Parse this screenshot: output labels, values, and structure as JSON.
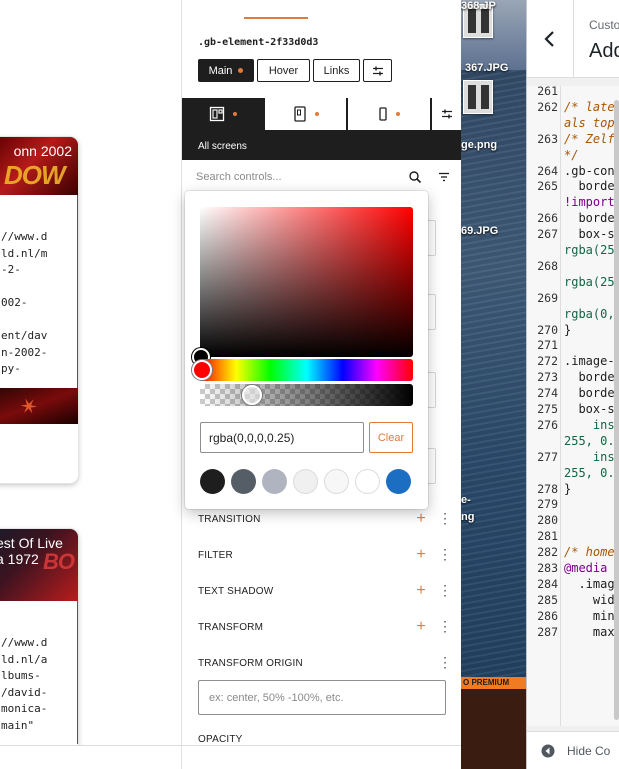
{
  "left_cards": [
    {
      "title": "onn 2002",
      "lines": [
        "//www.d",
        "ld.nl/m",
        "-2-",
        "",
        "002-",
        "",
        "ent/dav",
        "n-2002-",
        "py-"
      ]
    },
    {
      "title": "est Of Live\na 1972",
      "lines": [
        "//www.d",
        "ld.nl/a",
        "lbums-",
        "/david-",
        "monica-",
        "main\""
      ]
    }
  ],
  "inspector": {
    "element_class": ".gb-element-2f33d0d3",
    "states": [
      "Main",
      "Hover",
      "Links"
    ],
    "device_label": "All screens",
    "search_placeholder": "Search controls...",
    "controls": [
      {
        "label": "TRANSITION",
        "has_add": true
      },
      {
        "label": "FILTER",
        "has_add": true
      },
      {
        "label": "TEXT SHADOW",
        "has_add": true
      },
      {
        "label": "TRANSFORM",
        "has_add": true
      },
      {
        "label": "TRANSFORM ORIGIN",
        "has_add": false
      },
      {
        "label": "OPACITY",
        "has_add": false
      }
    ],
    "transform_origin_placeholder": "ex: center, 50% -100%, etc.",
    "accent_color": "#e17b3b"
  },
  "color_picker": {
    "value": "rgba(0,0,0,0.25)",
    "clear_label": "Clear",
    "swatches": [
      "#1e1e1e",
      "#555d66",
      "#b0b3c0",
      "#f0f0f0",
      "#f7f7f7",
      "#ffffff",
      "#1b6ec2"
    ]
  },
  "desktop": {
    "files": [
      "368.JP",
      "367.JPG",
      "ge.png",
      "69.JPG",
      "e-",
      "ng"
    ],
    "premium_label": "O PREMIUM"
  },
  "code_editor": {
    "subtitle": "Custo",
    "title": "Add",
    "line_numbers": [
      "261",
      "262",
      "",
      "263",
      "",
      "264",
      "265",
      "",
      "266",
      "267",
      "",
      "268",
      "",
      "269",
      "",
      "270",
      "271",
      "272",
      "273",
      "274",
      "275",
      "276",
      "",
      "277",
      "",
      "278",
      "279",
      "280",
      "281",
      "282",
      "283",
      "284",
      "285",
      "286",
      "287"
    ],
    "lines": [
      {
        "text": "",
        "style": "plain"
      },
      {
        "text": "/* late",
        "style": "comment"
      },
      {
        "text": "als top",
        "style": "comment"
      },
      {
        "text": "/* Zelf",
        "style": "comment"
      },
      {
        "text": "*/",
        "style": "comment"
      },
      {
        "text": ".gb-con",
        "style": "plain"
      },
      {
        "text": "  borde",
        "style": "plain"
      },
      {
        "text": "!import",
        "style": "purple"
      },
      {
        "text": "  borde",
        "style": "plain"
      },
      {
        "text": "  box-s",
        "style": "plain"
      },
      {
        "text": "rgba(25",
        "style": "green"
      },
      {
        "text": "",
        "style": "plain"
      },
      {
        "text": "rgba(25",
        "style": "green"
      },
      {
        "text": "",
        "style": "plain"
      },
      {
        "text": "rgba(0,",
        "style": "green"
      },
      {
        "text": "}",
        "style": "plain"
      },
      {
        "text": "",
        "style": "plain"
      },
      {
        "text": ".image-",
        "style": "plain"
      },
      {
        "text": "  borde",
        "style": "plain"
      },
      {
        "text": "  borde",
        "style": "plain"
      },
      {
        "text": "  box-s",
        "style": "plain"
      },
      {
        "text": "    ins",
        "style": "green"
      },
      {
        "text": "255, 0.",
        "style": "green"
      },
      {
        "text": "    ins",
        "style": "green"
      },
      {
        "text": "255, 0.",
        "style": "green"
      },
      {
        "text": "}",
        "style": "plain"
      },
      {
        "text": "",
        "style": "plain"
      },
      {
        "text": "",
        "style": "plain"
      },
      {
        "text": "",
        "style": "plain"
      },
      {
        "text": "/* home",
        "style": "comment"
      },
      {
        "text": "@media",
        "style": "purple"
      },
      {
        "text": "  .imag",
        "style": "plain"
      },
      {
        "text": "    wid",
        "style": "plain"
      },
      {
        "text": "    min",
        "style": "plain"
      },
      {
        "text": "    max",
        "style": "plain"
      }
    ],
    "footer_label": "Hide Co"
  }
}
